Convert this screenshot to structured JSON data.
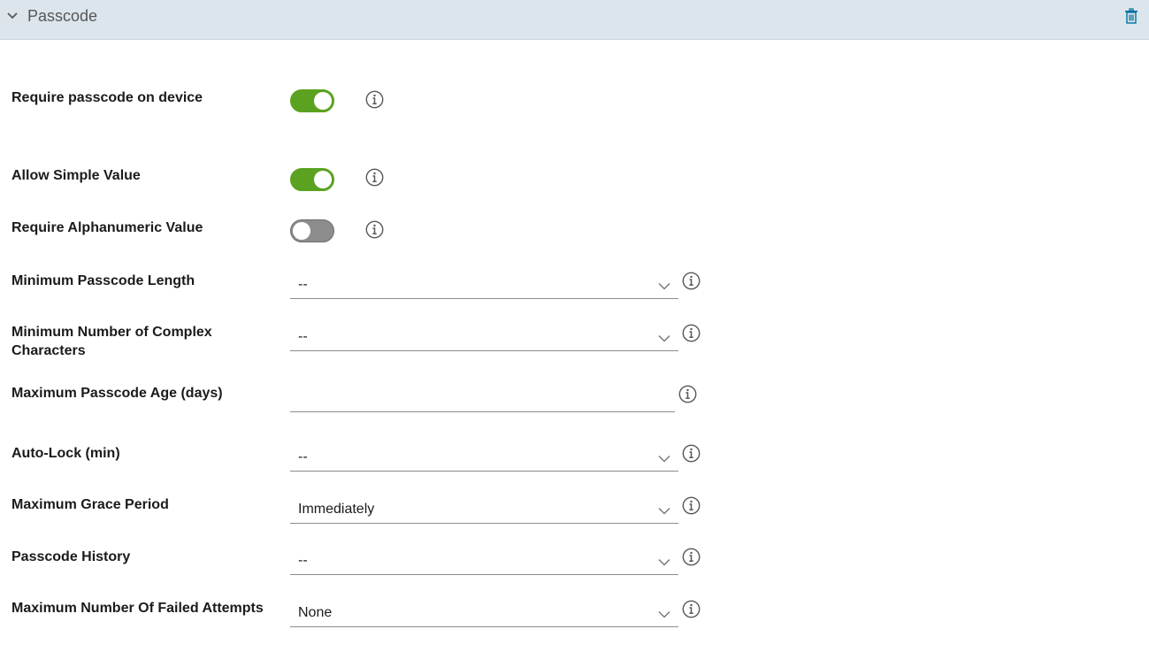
{
  "header": {
    "title": "Passcode",
    "chevron_icon": "chevron-down-icon",
    "delete_icon": "trash-icon",
    "accent_color": "#0072a3"
  },
  "colors": {
    "toggle_on": "#5aa220",
    "toggle_off": "#8c8c8c",
    "header_bg": "#dde5ec"
  },
  "fields": {
    "require_passcode": {
      "label": "Require passcode on device",
      "enabled": true
    },
    "allow_simple": {
      "label": "Allow Simple Value",
      "enabled": true
    },
    "require_alphanumeric": {
      "label": "Require Alphanumeric Value",
      "enabled": false
    },
    "min_length": {
      "label": "Minimum Passcode Length",
      "value": "--"
    },
    "min_complex": {
      "label": "Minimum Number of Complex Characters",
      "value": "--"
    },
    "max_age": {
      "label": "Maximum Passcode Age (days)",
      "value": "",
      "placeholder": ""
    },
    "auto_lock": {
      "label": "Auto-Lock (min)",
      "value": "--"
    },
    "grace_period": {
      "label": "Maximum Grace Period",
      "value": "Immediately"
    },
    "history": {
      "label": "Passcode History",
      "value": "--"
    },
    "failed_attempts": {
      "label": "Maximum Number Of Failed Attempts",
      "value": "None"
    }
  }
}
